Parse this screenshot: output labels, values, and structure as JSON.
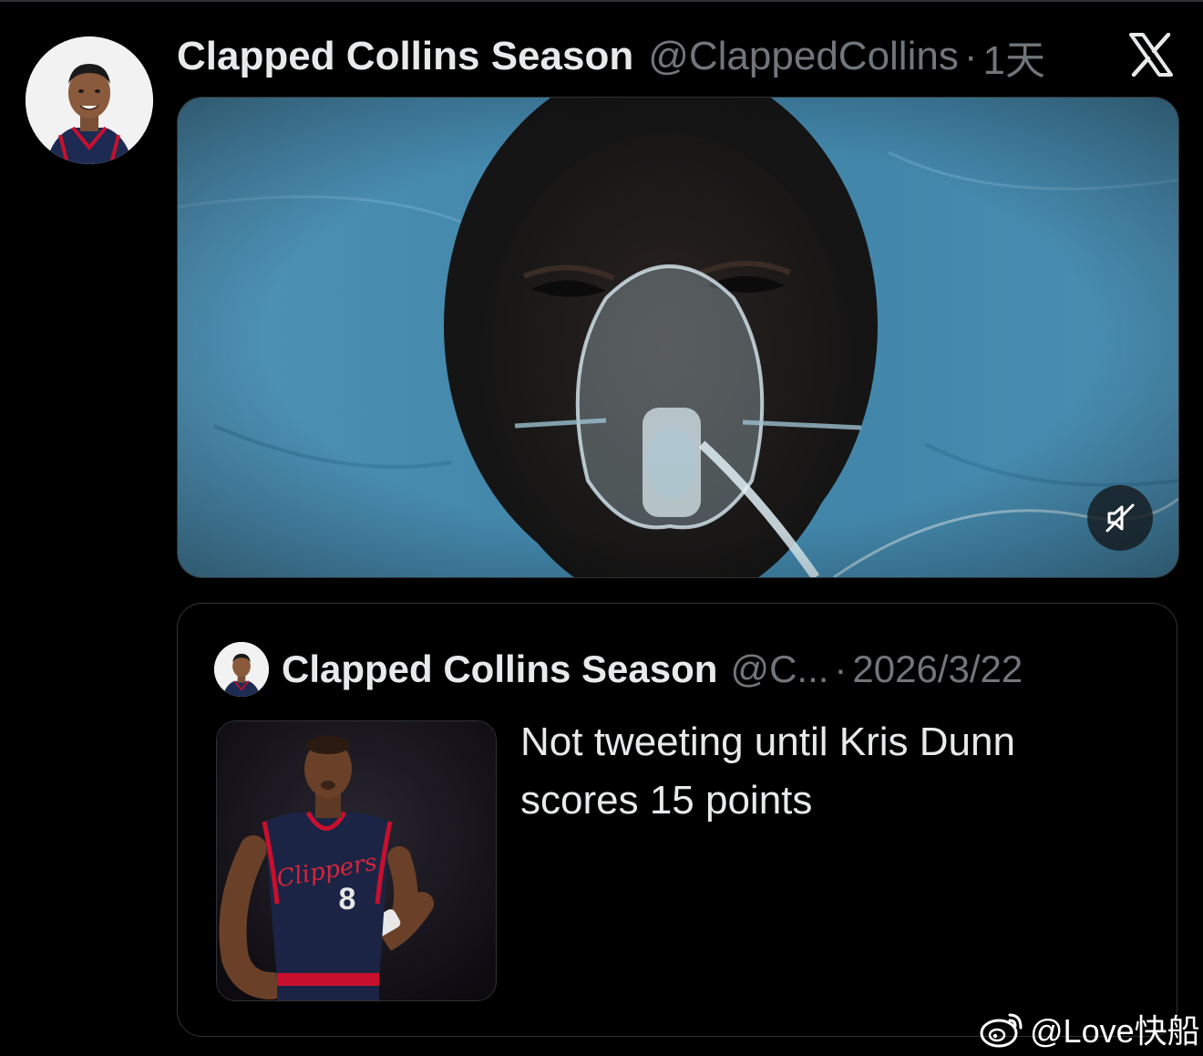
{
  "tweet": {
    "display_name": "Clapped Collins Season",
    "handle": "@ClappedCollins",
    "separator": "·",
    "time": "1天",
    "platform_icon": "x-logo-icon",
    "media": {
      "type": "video",
      "mute_icon": "volume-muted-icon"
    }
  },
  "quote": {
    "display_name": "Clapped Collins Season",
    "handle": "@C...",
    "separator": "·",
    "date": "2026/3/22",
    "text": "Not tweeting until Kris Dunn\nscores 15 points",
    "jersey_team": "Clippers",
    "jersey_number": "8"
  },
  "watermark": {
    "icon": "weibo-icon",
    "text": "@Love快船"
  },
  "colors": {
    "background": "#000000",
    "text_primary": "#e7e9ea",
    "text_secondary": "#71767b",
    "border": "#2f3336"
  }
}
